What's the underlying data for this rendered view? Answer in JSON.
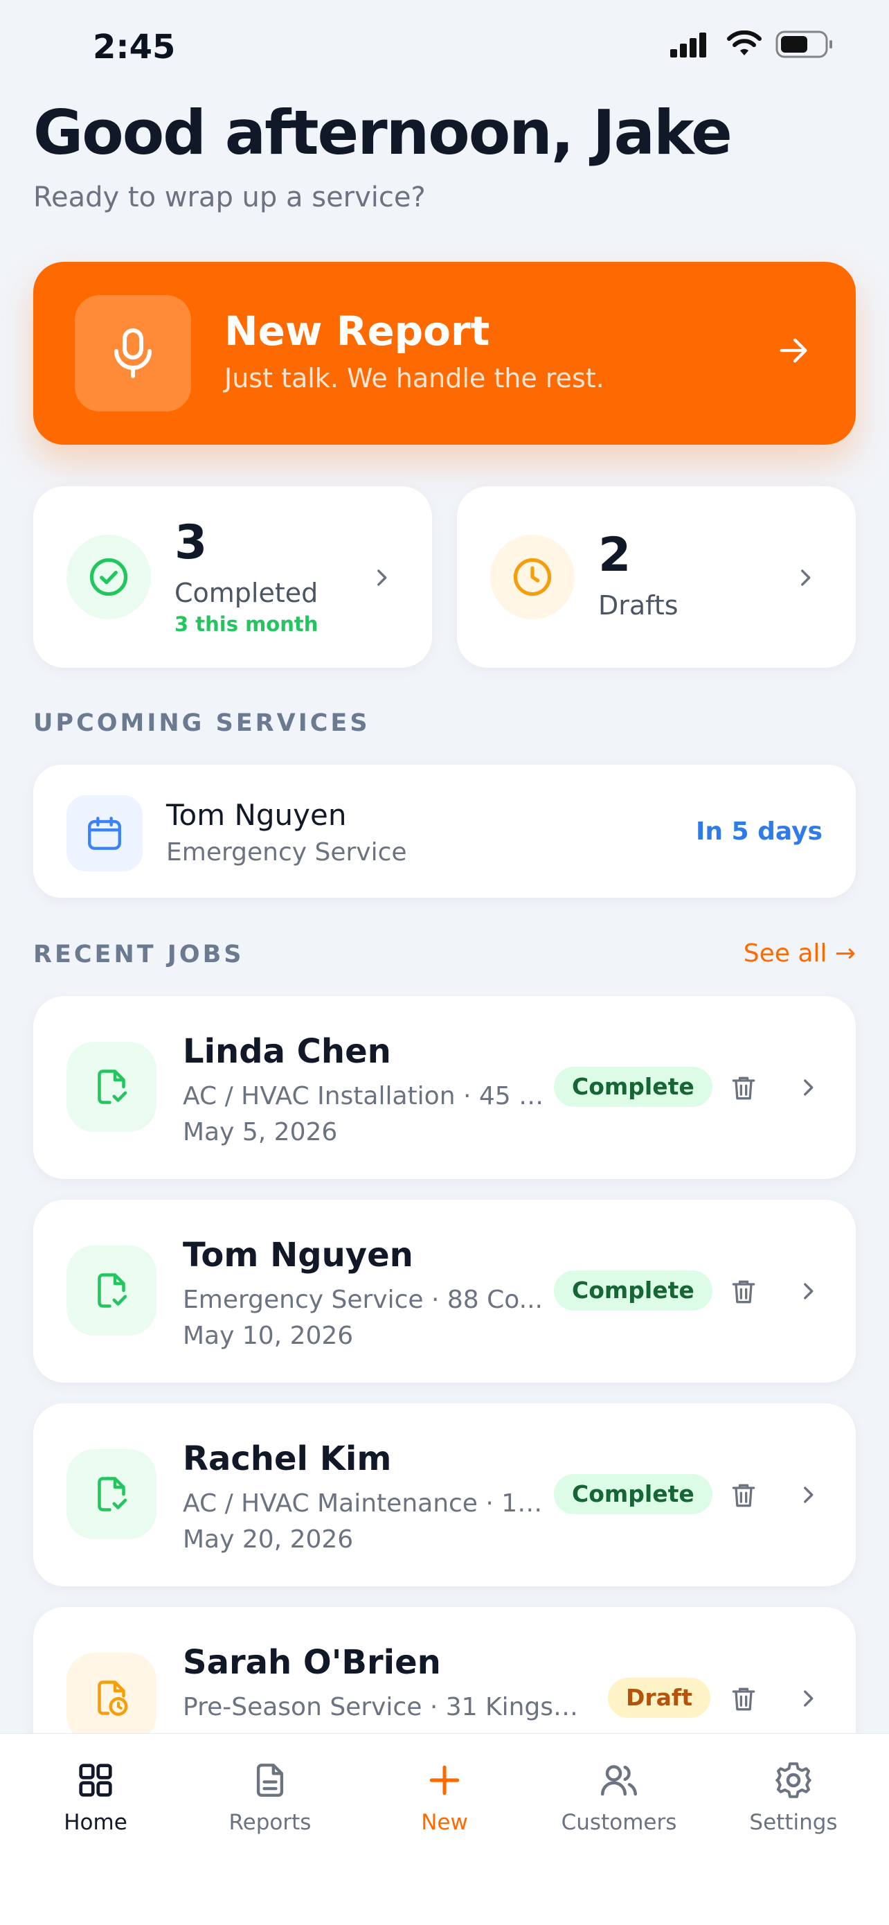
{
  "status_bar": {
    "time": "2:45"
  },
  "header": {
    "greeting": "Good afternoon, Jake",
    "subtitle": "Ready to wrap up a service?"
  },
  "new_report": {
    "title": "New Report",
    "subtitle": "Just talk. We handle the rest."
  },
  "stats": {
    "completed": {
      "count": "3",
      "label": "Completed",
      "note": "3 this month"
    },
    "drafts": {
      "count": "2",
      "label": "Drafts"
    }
  },
  "upcoming": {
    "heading": "UPCOMING SERVICES",
    "item": {
      "name": "Tom Nguyen",
      "service": "Emergency Service",
      "when": "In 5 days"
    }
  },
  "recent": {
    "heading": "RECENT JOBS",
    "see_all": "See all →",
    "jobs": [
      {
        "name": "Linda Chen",
        "detail": "AC / HVAC Installation · 45 M...",
        "date": "May 5, 2026",
        "status": "Complete"
      },
      {
        "name": "Tom Nguyen",
        "detail": "Emergency Service · 88 Co...",
        "date": "May 10, 2026",
        "status": "Complete"
      },
      {
        "name": "Rachel Kim",
        "detail": "AC / HVAC Maintenance · 14 ...",
        "date": "May 20, 2026",
        "status": "Complete"
      },
      {
        "name": "Sarah O'Brien",
        "detail": "Pre-Season Service · 31 Kingswa...",
        "date": "",
        "status": "Draft"
      }
    ]
  },
  "nav": {
    "home": "Home",
    "reports": "Reports",
    "new": "New",
    "customers": "Customers",
    "settings": "Settings"
  },
  "colors": {
    "accent": "#FF6A00",
    "success": "#22C55E",
    "info": "#2F7BE8",
    "warning": "#F59E0B"
  }
}
